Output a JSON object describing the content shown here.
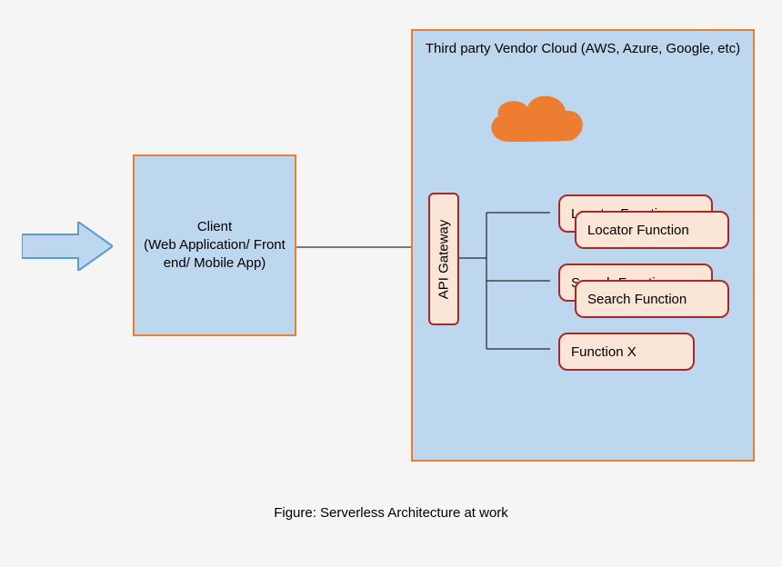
{
  "client": {
    "label": "Client\n(Web Application/ Front end/ Mobile App)"
  },
  "cloud": {
    "title": "Third party Vendor Cloud (AWS, Azure, Google, etc)"
  },
  "api_gateway": {
    "label": "API Gateway"
  },
  "functions": {
    "locator_back": "Locator Function",
    "locator_front": "Locator Function",
    "search_back": "Search Function",
    "search_front": "Search Function",
    "function_x": "Function X"
  },
  "caption": "Figure: Serverless Architecture at work"
}
